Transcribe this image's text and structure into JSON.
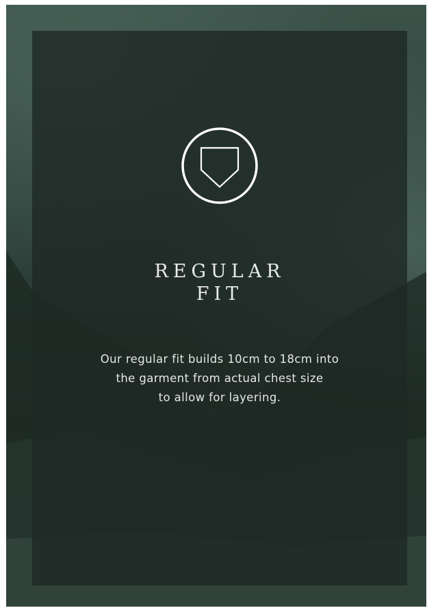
{
  "card": {
    "icon": "shield-icon",
    "title_line1": "REGULAR",
    "title_line2": "FIT",
    "description_line1": "Our regular fit builds 10cm to 18cm into",
    "description_line2": "the garment from actual chest size",
    "description_line3": "to allow for layering."
  },
  "colors": {
    "background": "#30443d",
    "panel": "#1e2824",
    "text": "#e9ece9"
  }
}
